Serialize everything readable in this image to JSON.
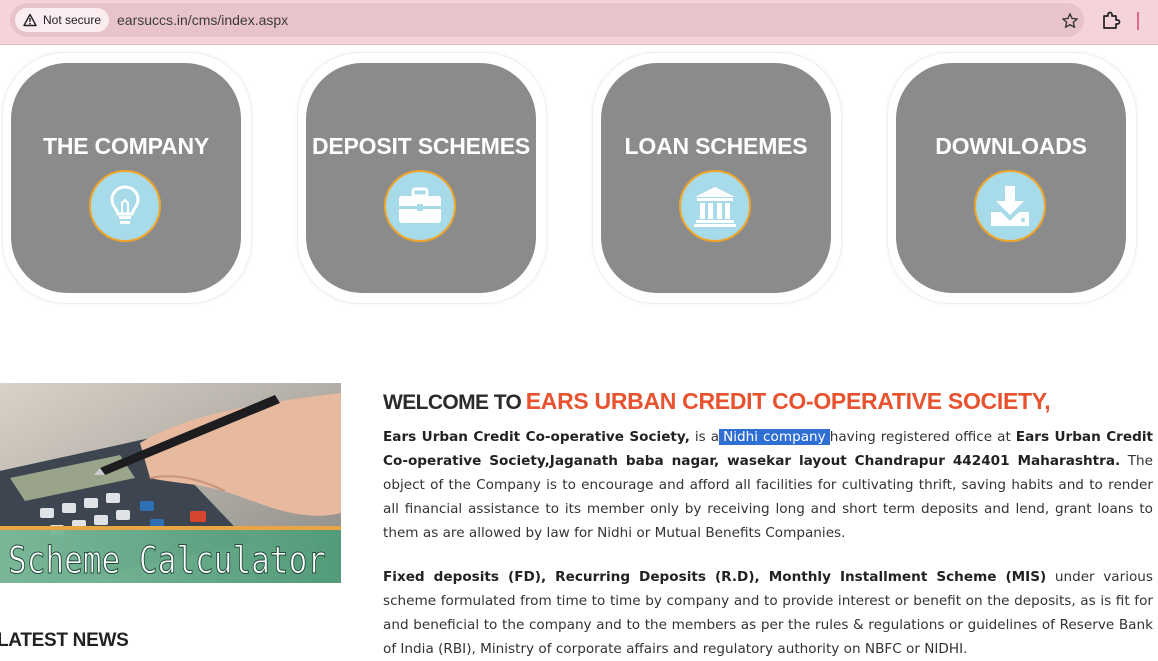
{
  "browser": {
    "security_label": "Not secure",
    "url": "earsuccs.in/cms/index.aspx"
  },
  "tiles": [
    {
      "title": "THE COMPANY",
      "icon": "lightbulb-icon"
    },
    {
      "title": "DEPOSIT SCHEMES",
      "icon": "briefcase-icon"
    },
    {
      "title": "LOAN SCHEMES",
      "icon": "bank-icon"
    },
    {
      "title": "DOWNLOADS",
      "icon": "download-icon"
    }
  ],
  "calculator_banner": {
    "text": "Scheme Calculator"
  },
  "latest_news": "LATEST NEWS",
  "welcome": {
    "prefix": "WELCOME TO",
    "name": "EARS URBAN CREDIT CO-OPERATIVE SOCIETY,"
  },
  "paragraph1": {
    "b1": "Ears Urban Credit Co-operative Society,",
    "t1": " is a",
    "highlight": "Nidhi company",
    "t2": "having registered office at ",
    "b2": "Ears Urban Credit Co-operative Society,Jaganath baba nagar, wasekar layout Chandrapur 442401 Maharashtra.",
    "t3": " The object of the Company is to encourage and afford all facilities for cultivating thrift, saving habits and to render all financial assistance to its member only by receiving long and short term deposits and lend, grant loans to them as are allowed by law for Nidhi or Mutual Benefits Companies."
  },
  "paragraph2": {
    "b1": "Fixed deposits (FD), Recurring Deposits (R.D), Monthly Installment Scheme (MIS)",
    "t1": " under various scheme formulated from time to time by company and to provide interest or benefit on the deposits, as is fit for and beneficial to the company and to the members as per the rules & regulations or guidelines of Reserve Bank of India (RBI), Ministry of corporate affairs and regulatory authority on NBFC or NIDHI."
  },
  "colors": {
    "tile_bg": "#8b8b8c",
    "icon_circle": "#a7dbe9",
    "icon_ring": "#f0a52a",
    "accent_red": "#e8522f",
    "selection": "#2f6fd4"
  }
}
